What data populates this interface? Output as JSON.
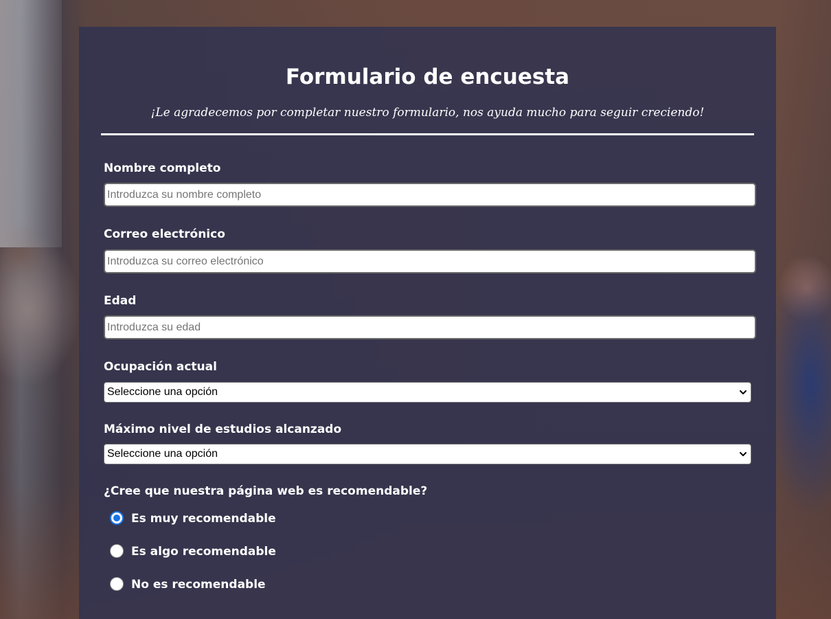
{
  "form": {
    "title": "Formulario de encuesta",
    "subtitle": "¡Le agradecemos por completar nuestro formulario, nos ayuda mucho para seguir creciendo!",
    "name": {
      "label": "Nombre completo",
      "placeholder": "Introduzca su nombre completo",
      "value": ""
    },
    "email": {
      "label": "Correo electrónico",
      "placeholder": "Introduzca su correo electrónico",
      "value": ""
    },
    "age": {
      "label": "Edad",
      "placeholder": "Introduzca su edad",
      "value": ""
    },
    "occupation": {
      "label": "Ocupación actual",
      "selected": "Seleccione una opción"
    },
    "education": {
      "label": "Máximo nivel de estudios alcanzado",
      "selected": "Seleccione una opción"
    },
    "recommend": {
      "question": "¿Cree que nuestra página web es recomendable?",
      "options": [
        {
          "label": "Es muy recomendable",
          "checked": true
        },
        {
          "label": "Es algo recomendable",
          "checked": false
        },
        {
          "label": "No es recomendable",
          "checked": false
        }
      ]
    }
  },
  "colors": {
    "panel": "#323350",
    "text": "#ffffff",
    "radio_accent": "#1a73e8"
  },
  "icons": {
    "select_arrow": "chevron-down-icon"
  }
}
